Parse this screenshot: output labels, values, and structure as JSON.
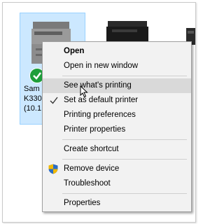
{
  "devices": {
    "selected_printer": {
      "name_line1": "Sam",
      "name_line2": "K330",
      "name_line3": "(10.1"
    }
  },
  "context_menu": {
    "items": [
      {
        "label": "Open"
      },
      {
        "label": "Open in new window"
      },
      {
        "label": "See what's printing"
      },
      {
        "label": "Set as default printer"
      },
      {
        "label": "Printing preferences"
      },
      {
        "label": "Printer properties"
      },
      {
        "label": "Create shortcut"
      },
      {
        "label": "Remove device"
      },
      {
        "label": "Troubleshoot"
      },
      {
        "label": "Properties"
      }
    ]
  },
  "colors": {
    "selection_tile": "#cce8ff",
    "menu_background": "#f2f2f2",
    "hover_highlight": "#d9d9d9",
    "default_badge": "#1e9e3a"
  },
  "icons": {
    "default_badge": "green-check-icon",
    "remove_device": "uac-shield-icon",
    "set_default_indicator": "checkmark-icon",
    "pointer": "mouse-cursor-icon"
  }
}
